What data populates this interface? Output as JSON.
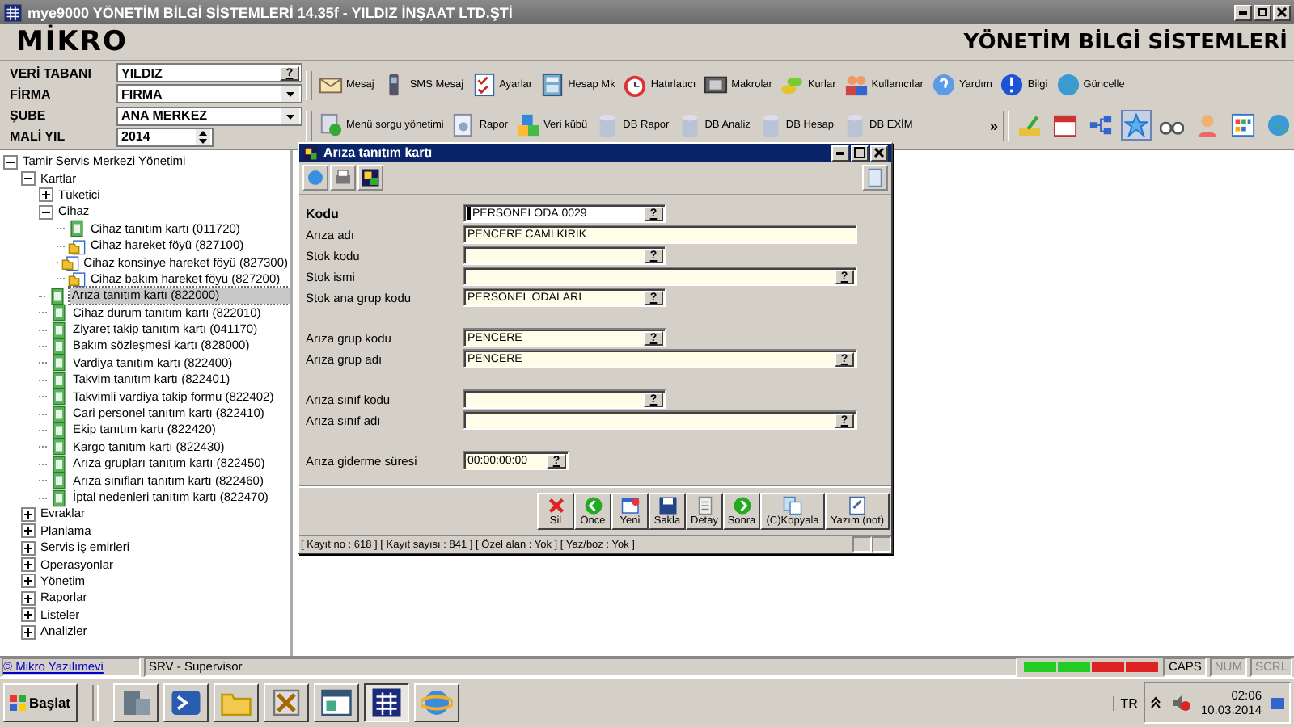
{
  "window": {
    "title": "mye9000 YÖNETİM BİLGİ SİSTEMLERİ 14.35f - YILDIZ İNŞAAT LTD.ŞTİ"
  },
  "header": {
    "logo": "MİKRO",
    "tagline": "YÖNETİM BİLGİ SİSTEMLERİ"
  },
  "context_fields": [
    {
      "label": "VERİ TABANI",
      "value": "YILDIZ",
      "kind": "lookup",
      "lookup_button": "?"
    },
    {
      "label": "FİRMA",
      "value": "FIRMA",
      "kind": "dropdown"
    },
    {
      "label": "ŞUBE",
      "value": "ANA MERKEZ",
      "kind": "dropdown"
    },
    {
      "label": "MALİ YIL",
      "value": "2014",
      "kind": "spinner"
    }
  ],
  "toolbar_row_1": [
    {
      "label": "Mesaj"
    },
    {
      "label": "SMS Mesaj"
    },
    {
      "label": "Ayarlar"
    },
    {
      "label": "Hesap Mk"
    },
    {
      "label": "Hatırlatıcı"
    },
    {
      "label": "Makrolar"
    },
    {
      "label": "Kurlar"
    },
    {
      "label": "Kullanıcılar"
    },
    {
      "label": "Yardım"
    },
    {
      "label": "Bilgi"
    },
    {
      "label": "Güncelle"
    }
  ],
  "toolbar_row_2": [
    {
      "label": "Menü sorgu yönetimi"
    },
    {
      "label": "Rapor"
    },
    {
      "label": "Veri kübü"
    },
    {
      "label": "DB Rapor"
    },
    {
      "label": "DB Analiz"
    },
    {
      "label": "DB Hesap"
    },
    {
      "label": "DB EXİM"
    }
  ],
  "toolbar_overflow": "»",
  "quick_icons": [
    {
      "selected": false
    },
    {
      "selected": false
    },
    {
      "selected": false
    },
    {
      "selected": true
    },
    {
      "selected": false
    },
    {
      "selected": false
    },
    {
      "selected": false
    },
    {
      "selected": false
    }
  ],
  "tree": [
    {
      "label": "Tamir Servis Merkezi Yönetimi",
      "expanded": true,
      "children": [
        {
          "label": "Kartlar",
          "expanded": true,
          "children": [
            {
              "label": "Tüketici",
              "expanded": false
            },
            {
              "label": "Cihaz",
              "expanded": true,
              "children": [
                {
                  "label": "Cihaz tanıtım kartı (011720)",
                  "kind": "card",
                  "selected": false
                },
                {
                  "label": "Cihaz hareket föyü (827100)",
                  "kind": "movement",
                  "selected": false
                },
                {
                  "label": "Cihaz konsinye hareket föyü (827300)",
                  "kind": "movement",
                  "selected": false
                },
                {
                  "label": "Cihaz bakım hareket föyü (827200)",
                  "kind": "movement",
                  "selected": false
                }
              ]
            },
            {
              "label": "Arıza tanıtım kartı (822000)",
              "kind": "card",
              "selected": true
            },
            {
              "label": "Cihaz durum tanıtım kartı (822010)",
              "kind": "card",
              "selected": false
            },
            {
              "label": "Ziyaret takip tanıtım kartı (041170)",
              "kind": "card",
              "selected": false
            },
            {
              "label": "Bakım sözleşmesi kartı (828000)",
              "kind": "card",
              "selected": false
            },
            {
              "label": "Vardiya tanıtım kartı (822400)",
              "kind": "card",
              "selected": false
            },
            {
              "label": "Takvim tanıtım kartı (822401)",
              "kind": "card",
              "selected": false
            },
            {
              "label": "Takvimli vardiya takip formu (822402)",
              "kind": "card",
              "selected": false
            },
            {
              "label": "Cari personel tanıtım kartı (822410)",
              "kind": "card",
              "selected": false
            },
            {
              "label": "Ekip tanıtım kartı (822420)",
              "kind": "card",
              "selected": false
            },
            {
              "label": "Kargo tanıtım kartı (822430)",
              "kind": "card",
              "selected": false
            },
            {
              "label": "Arıza grupları tanıtım kartı (822450)",
              "kind": "card",
              "selected": false
            },
            {
              "label": "Arıza sınıfları tanıtım kartı (822460)",
              "kind": "card",
              "selected": false
            },
            {
              "label": "İptal nedenleri tanıtım kartı (822470)",
              "kind": "card",
              "selected": false
            }
          ]
        },
        {
          "label": "Evraklar",
          "expanded": false
        },
        {
          "label": "Planlama",
          "expanded": false
        },
        {
          "label": "Servis iş emirleri",
          "expanded": false
        },
        {
          "label": "Operasyonlar",
          "expanded": false
        },
        {
          "label": "Yönetim",
          "expanded": false
        },
        {
          "label": "Raporlar",
          "expanded": false
        },
        {
          "label": "Listeler",
          "expanded": false
        },
        {
          "label": "Analizler",
          "expanded": false
        }
      ]
    }
  ],
  "dialog": {
    "title": "Arıza tanıtım kartı",
    "field_groups": [
      [
        {
          "label": "Kodu",
          "value": "PERSONELODA.0029",
          "kind": "short",
          "lookup_button": "?",
          "required": true,
          "focused": true
        },
        {
          "label": "Arıza adı",
          "value": "PENCERE CAMI KIRIK",
          "kind": "long",
          "required": false,
          "focused": false
        },
        {
          "label": "Stok kodu",
          "kind": "short",
          "lookup_button": "?",
          "required": false,
          "focused": false
        },
        {
          "label": "Stok ismi",
          "kind": "long",
          "lookup_button": "?",
          "required": false,
          "focused": false
        },
        {
          "label": "Stok ana grup kodu",
          "value": "PERSONEL ODALARI",
          "kind": "short",
          "lookup_button": "?",
          "required": false,
          "focused": false
        }
      ],
      [
        {
          "label": "Arıza grup kodu",
          "value": "PENCERE",
          "kind": "short",
          "lookup_button": "?",
          "required": false,
          "focused": false
        },
        {
          "label": "Arıza grup adı",
          "value": "PENCERE",
          "kind": "long",
          "lookup_button": "?",
          "required": false,
          "focused": false
        }
      ],
      [
        {
          "label": "Arıza sınıf kodu",
          "kind": "short",
          "lookup_button": "?",
          "required": false,
          "focused": false
        },
        {
          "label": "Arıza sınıf adı",
          "kind": "long",
          "lookup_button": "?",
          "required": false,
          "focused": false
        }
      ],
      [
        {
          "label": "Arıza giderme süresi",
          "value": "00:00:00:00",
          "kind": "time",
          "lookup_button": "?",
          "required": false,
          "focused": false
        }
      ]
    ],
    "buttons": [
      {
        "label": "Sil",
        "kind": "delete"
      },
      {
        "label": "Önce",
        "kind": "previous"
      },
      {
        "label": "Yeni",
        "kind": "new"
      },
      {
        "label": "Sakla",
        "kind": "save"
      },
      {
        "label": "Detay",
        "kind": "detail"
      },
      {
        "label": "Sonra",
        "kind": "next"
      },
      {
        "label": "(C)Kopyala",
        "kind": "copy"
      },
      {
        "label": "Yazım (not)",
        "kind": "note"
      }
    ],
    "status": "[ Kayıt no : 618 ] [ Kayıt sayısı : 841 ] [ Özel alan : Yok ] [ Yaz/boz : Yok ]"
  },
  "status_bar": {
    "link": "© Mikro Yazılımevi",
    "user": "SRV - Supervisor",
    "keys": [
      {
        "label": "CAPS",
        "on": true
      },
      {
        "label": "NUM",
        "on": false
      },
      {
        "label": "SCRL",
        "on": false
      }
    ]
  },
  "taskbar": {
    "start": "Başlat",
    "apps": [
      {
        "selected": false
      },
      {
        "selected": false
      },
      {
        "selected": false
      },
      {
        "selected": false
      },
      {
        "selected": false
      },
      {
        "selected": true
      },
      {
        "selected": false
      }
    ],
    "language": "TR",
    "time": "02:06",
    "date": "10.03.2014"
  }
}
